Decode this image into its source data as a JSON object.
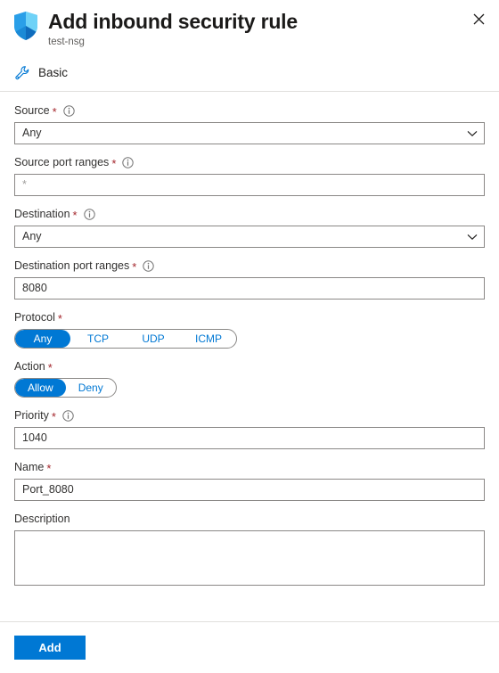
{
  "header": {
    "title": "Add inbound security rule",
    "subtitle": "test-nsg",
    "close_label": "×",
    "shield_icon": "shield-icon",
    "close_icon": "close-icon"
  },
  "tool_row": {
    "label": "Basic",
    "icon": "wrench-icon"
  },
  "form": {
    "source": {
      "label": "Source",
      "required": "*",
      "info_icon": "info-icon",
      "value": "Any",
      "chevron_icon": "chevron-down-icon"
    },
    "source_port_ranges": {
      "label": "Source port ranges",
      "required": "*",
      "info_icon": "info-icon",
      "value": "*"
    },
    "destination": {
      "label": "Destination",
      "required": "*",
      "info_icon": "info-icon",
      "value": "Any",
      "chevron_icon": "chevron-down-icon"
    },
    "destination_port_ranges": {
      "label": "Destination port ranges",
      "required": "*",
      "info_icon": "info-icon",
      "value": "8080"
    },
    "protocol": {
      "label": "Protocol",
      "required": "*",
      "options": [
        "Any",
        "TCP",
        "UDP",
        "ICMP"
      ],
      "selected": "Any"
    },
    "action": {
      "label": "Action",
      "required": "*",
      "options": [
        "Allow",
        "Deny"
      ],
      "selected": "Allow"
    },
    "priority": {
      "label": "Priority",
      "required": "*",
      "info_icon": "info-icon",
      "value": "1040"
    },
    "name": {
      "label": "Name",
      "required": "*",
      "value": "Port_8080"
    },
    "description": {
      "label": "Description",
      "value": ""
    }
  },
  "footer": {
    "add_label": "Add"
  },
  "colors": {
    "accent": "#0078d4",
    "required_star": "#a4262c",
    "border": "#8a8886",
    "divider": "#e1dfdd",
    "text": "#201f1e",
    "muted_text": "#605e5c"
  }
}
